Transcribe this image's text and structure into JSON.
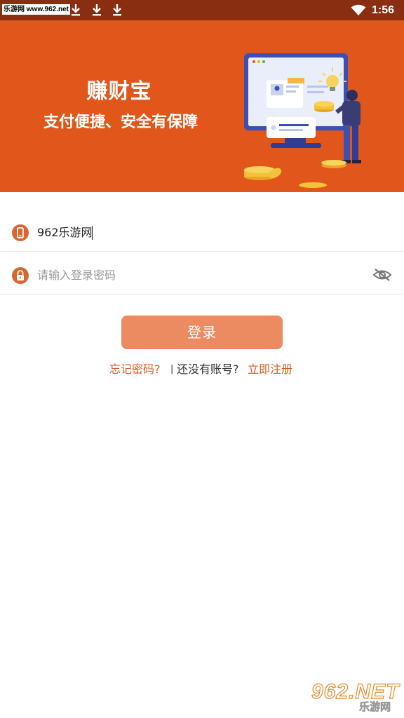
{
  "status_bar": {
    "watermark_label": "乐游网 www.962.net",
    "time": "1:56",
    "icons": [
      "download-icon",
      "download-icon",
      "download-icon",
      "wifi-icon"
    ]
  },
  "banner": {
    "title": "赚财宝",
    "subtitle": "支付便捷、安全有保障",
    "background_color": "#e1561b"
  },
  "form": {
    "phone": {
      "icon": "phone-icon",
      "value": "962乐游网",
      "placeholder": ""
    },
    "password": {
      "icon": "lock-icon",
      "value": "",
      "placeholder": "请输入登录密码",
      "toggle_icon": "eye-hidden-icon"
    },
    "login_label": "登录"
  },
  "links": {
    "forgot": "忘记密码?",
    "separator": "|",
    "no_account": "还没有账号?",
    "register": "立即注册"
  },
  "watermark": {
    "brand": "962.NET",
    "sub": "乐游网"
  },
  "colors": {
    "accent": "#e1561b",
    "button": "#ec8a62",
    "link": "#d45a23",
    "status_bar": "#8a2e12"
  }
}
